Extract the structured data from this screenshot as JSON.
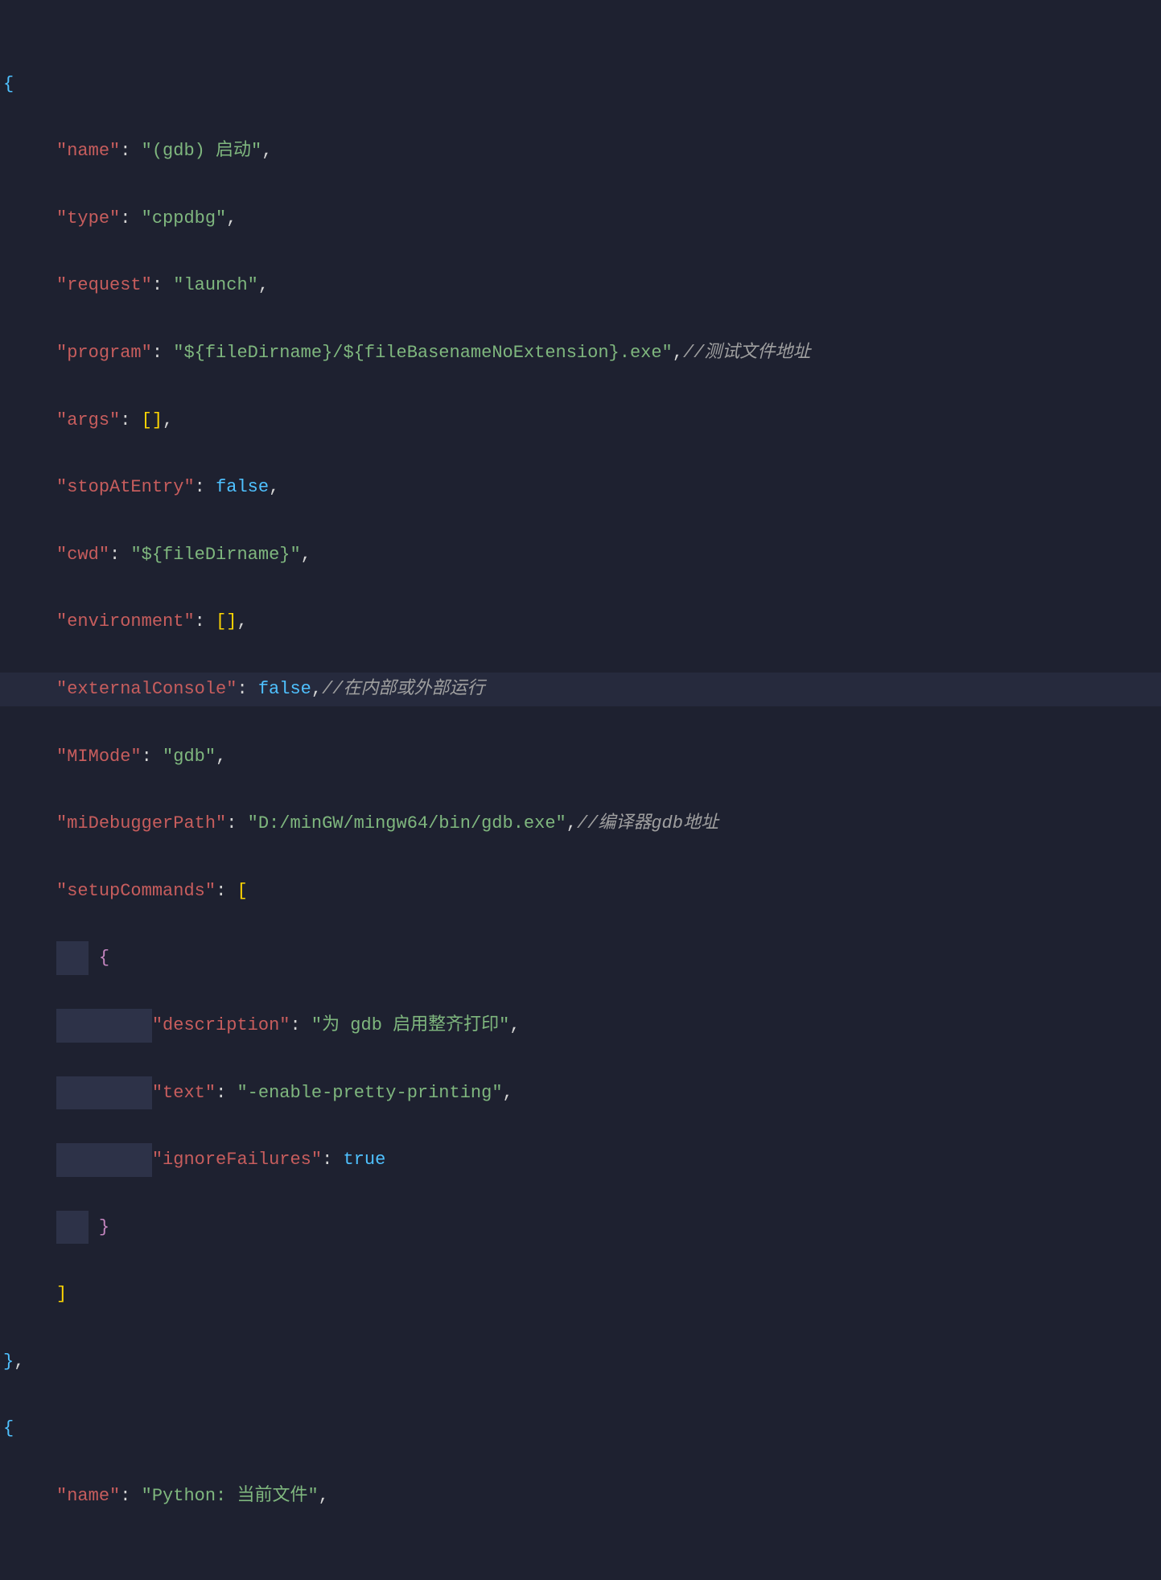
{
  "lines": {
    "l0_brace": "{",
    "l1_key": "\"name\"",
    "l1_colon": ": ",
    "l1_val": "\"(gdb) 启动\"",
    "l1_comma": ",",
    "l2_key": "\"type\"",
    "l2_colon": ": ",
    "l2_val": "\"cppdbg\"",
    "l2_comma": ",",
    "l3_key": "\"request\"",
    "l3_colon": ": ",
    "l3_val": "\"launch\"",
    "l3_comma": ",",
    "l4_key": "\"program\"",
    "l4_colon": ": ",
    "l4_val": "\"${fileDirname}/${fileBasenameNoExtension}.exe\"",
    "l4_comma": ",",
    "l4_cmt": "//测试文件地址",
    "l5_key": "\"args\"",
    "l5_colon": ": ",
    "l5_lb": "[",
    "l5_rb": "]",
    "l5_comma": ",",
    "l6_key": "\"stopAtEntry\"",
    "l6_colon": ": ",
    "l6_val": "false",
    "l6_comma": ",",
    "l7_key": "\"cwd\"",
    "l7_colon": ": ",
    "l7_val": "\"${fileDirname}\"",
    "l7_comma": ",",
    "l8_key": "\"environment\"",
    "l8_colon": ": ",
    "l8_lb": "[",
    "l8_rb": "]",
    "l8_comma": ",",
    "l9_key": "\"externalConsole\"",
    "l9_colon": ": ",
    "l9_val": "false",
    "l9_comma": ",",
    "l9_cmt": "//在内部或外部运行",
    "l10_key": "\"MIMode\"",
    "l10_colon": ": ",
    "l10_val": "\"gdb\"",
    "l10_comma": ",",
    "l11_key": "\"miDebuggerPath\"",
    "l11_colon": ": ",
    "l11_val": "\"D:/minGW/mingw64/bin/gdb.exe\"",
    "l11_comma": ",",
    "l11_cmt": "//编译器gdb地址",
    "l12_key": "\"setupCommands\"",
    "l12_colon": ": ",
    "l12_lb": "[",
    "l13_brace": "{",
    "l14_key": "\"description\"",
    "l14_colon": ": ",
    "l14_val": "\"为 gdb 启用整齐打印\"",
    "l14_comma": ",",
    "l15_key": "\"text\"",
    "l15_colon": ": ",
    "l15_val": "\"-enable-pretty-printing\"",
    "l15_comma": ",",
    "l16_key": "\"ignoreFailures\"",
    "l16_colon": ": ",
    "l16_val": "true",
    "l17_brace": "}",
    "l18_rb": "]",
    "l19_brace": "}",
    "l19_comma": ",",
    "l20_brace": "{",
    "l21_key": "\"name\"",
    "l21_colon": ": ",
    "l21_val": "\"Python: 当前文件\"",
    "l21_comma": ","
  }
}
